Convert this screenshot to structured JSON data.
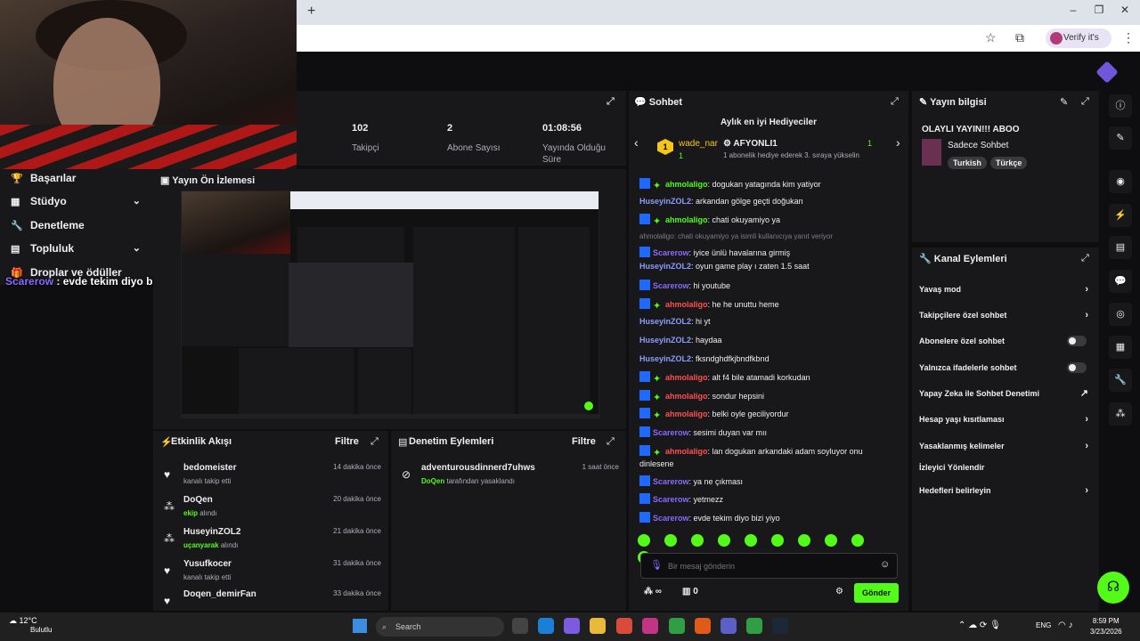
{
  "browser": {
    "new_tab": "+",
    "verify_label": "Verify it's you",
    "window_controls": [
      "–",
      "❐",
      "✕"
    ]
  },
  "sidebar": {
    "items": [
      {
        "label": "Başarılar",
        "icon": "trophy-icon"
      },
      {
        "label": "Stüdyo",
        "icon": "studio-icon",
        "expandable": true
      },
      {
        "label": "Denetleme",
        "icon": "wrench-icon"
      },
      {
        "label": "Topluluk",
        "icon": "community-icon",
        "expandable": true
      },
      {
        "label": "Droplar ve ödüller",
        "icon": "gift-icon"
      }
    ],
    "overlay_chat": {
      "user": "Scarerow",
      "text": " : evde tekim diyo bizi yiyo"
    }
  },
  "stats": [
    {
      "value": "102",
      "label": "Takipçi"
    },
    {
      "value": "2",
      "label": "Abone Sayısı"
    },
    {
      "value": "01:08:56",
      "label": "Yayında Olduğu Süre"
    }
  ],
  "preview": {
    "title": "Yayın Ön İzlemesi"
  },
  "activity": {
    "title": "Etkinlik Akışı",
    "filter": "Filtre",
    "items": [
      {
        "name": "bedomeister",
        "desc": "kanalı takip etti",
        "highlight": "",
        "time": "14 dakika önce",
        "icon": "heart-icon"
      },
      {
        "name": "DoQen",
        "desc": "alındı",
        "highlight": "ekip",
        "time": "20 dakika önce",
        "icon": "drops-icon"
      },
      {
        "name": "HuseyinZOL2",
        "desc": "alındı",
        "highlight": "uçanyarak",
        "time": "21 dakika önce",
        "icon": "drops-icon"
      },
      {
        "name": "Yusufkocer",
        "desc": "kanalı takip etti",
        "highlight": "",
        "time": "31 dakika önce",
        "icon": "heart-icon"
      },
      {
        "name": "Doqen_demirFan",
        "desc": "",
        "highlight": "",
        "time": "33 dakika önce",
        "icon": "heart-icon"
      }
    ]
  },
  "moderation": {
    "title": "Denetim Eylemleri",
    "filter": "Filtre",
    "items": [
      {
        "name": "adventurousdinnerd7uhws",
        "actor": "DoQen",
        "desc": "tarafından yasaklandı",
        "time": "1 saat önce"
      }
    ]
  },
  "chat": {
    "title": "Sohbet",
    "gifters_title": "Aylık en iyi Hediyeciler",
    "gifter1": {
      "rank": "1",
      "name": "wade_nar",
      "count": "1"
    },
    "gifter2": {
      "name": "AFYONLI1",
      "count": "1",
      "sub": "1 abonelik hediye ederek 3. sıraya yükselin"
    },
    "messages": [
      {
        "user": "ahmolaligo",
        "color": "green",
        "badges": 2,
        "text": ": dogukan yatagında kim yatiyor"
      },
      {
        "user": "HuseyinZOL2",
        "color": "blue",
        "badges": 0,
        "text": ": arkandan gölge geçti doğukan"
      },
      {
        "user": "ahmolaligo",
        "color": "green",
        "badges": 2,
        "text": ": chati okuyamiyo ya"
      },
      {
        "user": "Scarerow",
        "color": "purple",
        "badges": 1,
        "text": ": iyice ünlü havalarına girmiş",
        "reply": "ahmolaligo: chati okuyamiyo ya isimli kullanıcıya yanıt veriyor"
      },
      {
        "user": "HuseyinZOL2",
        "color": "blue",
        "badges": 0,
        "text": ": oyun game play ı zaten 1.5 saat"
      },
      {
        "user": "Scarerow",
        "color": "purple",
        "badges": 1,
        "text": ": hi youtube"
      },
      {
        "user": "ahmolaligo",
        "color": "red",
        "badges": 2,
        "text": ": he he unuttu heme"
      },
      {
        "user": "HuseyinZOL2",
        "color": "blue",
        "badges": 0,
        "text": ": hi yt"
      },
      {
        "user": "HuseyinZOL2",
        "color": "blue",
        "badges": 0,
        "text": ": haydaa"
      },
      {
        "user": "HuseyinZOL2",
        "color": "blue",
        "badges": 0,
        "text": ": fksndghdfkjbndfkbnd"
      },
      {
        "user": "ahmolaligo",
        "color": "red",
        "badges": 2,
        "text": ": alt f4 bile atamadi korkudan"
      },
      {
        "user": "ahmolaligo",
        "color": "red",
        "badges": 2,
        "text": ": sondur hepsini"
      },
      {
        "user": "ahmolaligo",
        "color": "red",
        "badges": 2,
        "text": ": belki oyle geciliyordur"
      },
      {
        "user": "Scarerow",
        "color": "purple",
        "badges": 1,
        "text": ": sesimi duyan var mıı"
      },
      {
        "user": "ahmolaligo",
        "color": "red",
        "badges": 2,
        "text": ": lan dogukan arkandaki adam soyluyor onu dinlesene"
      },
      {
        "user": "Scarerow",
        "color": "purple",
        "badges": 1,
        "text": ": ya ne çıkması"
      },
      {
        "user": "Scarerow",
        "color": "purple",
        "badges": 1,
        "text": ": yetmezz"
      },
      {
        "user": "Scarerow",
        "color": "purple",
        "badges": 1,
        "text": ": evde tekim diyo bizi yiyo"
      }
    ],
    "input_placeholder": "Bir mesaj gönderin",
    "points": "∞",
    "gift_count": "0",
    "send_label": "Gönder"
  },
  "stream_info": {
    "title": "Yayın bilgisi",
    "stream_title": "OLAYLI YAYIN!!! ABOO",
    "category": "Sadece Sohbet",
    "tags": [
      "Turkish",
      "Türkçe"
    ]
  },
  "channel_actions": {
    "title": "Kanal Eylemleri",
    "items": [
      {
        "label": "Yavaş mod",
        "control": "chevron"
      },
      {
        "label": "Takipçilere özel sohbet",
        "control": "chevron"
      },
      {
        "label": "Abonelere özel sohbet",
        "control": "toggle"
      },
      {
        "label": "Yalnızca ifadelerle sohbet",
        "control": "toggle"
      },
      {
        "label": "Yapay Zeka ile Sohbet Denetimi",
        "control": "external"
      },
      {
        "label": "Hesap yaşı kısıtlaması",
        "control": "chevron"
      },
      {
        "label": "Yasaklanmış kelimeler",
        "control": "chevron"
      },
      {
        "label": "İzleyici Yönlendir",
        "control": "none"
      },
      {
        "label": "Hedefleri belirleyin",
        "control": "chevron"
      }
    ]
  },
  "taskbar": {
    "temp": "12°C",
    "weather": "Bulutlu",
    "search": "Search",
    "lang": "ENG",
    "time": "8:59 PM",
    "date": "3/23/2026"
  },
  "colors": {
    "accent": "#53fc18",
    "bg": "#0e0e10",
    "panel": "#18181b"
  }
}
